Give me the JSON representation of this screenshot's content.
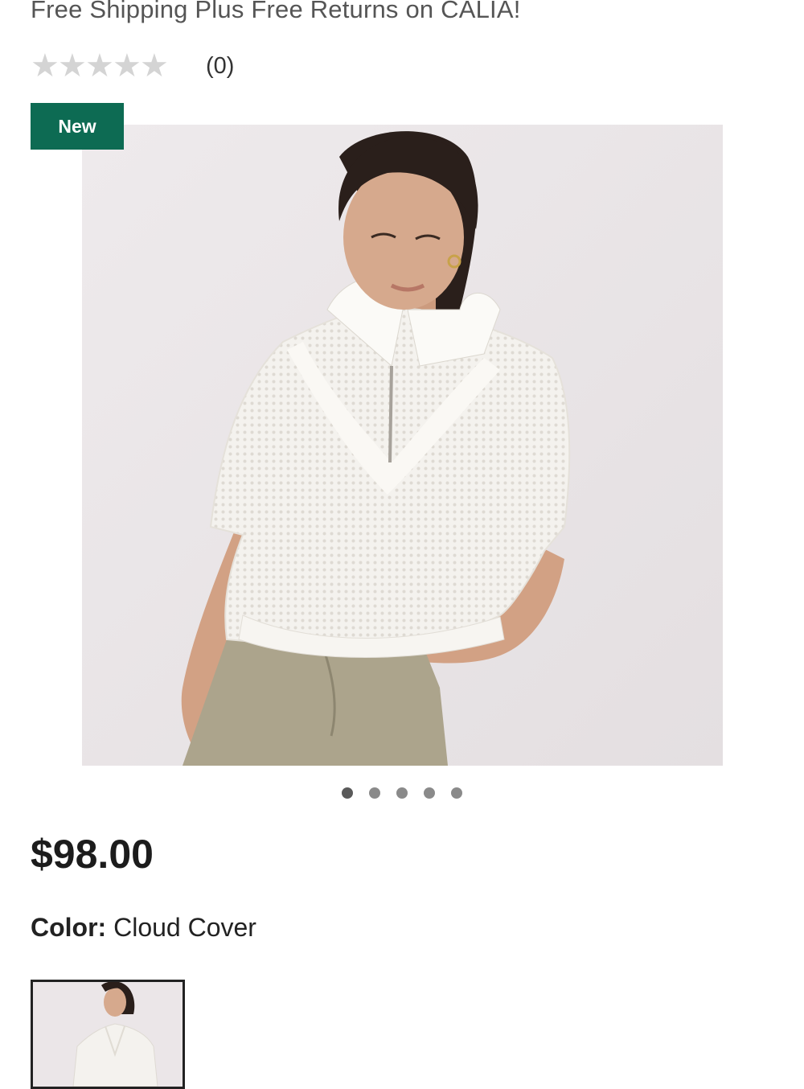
{
  "promo": {
    "text": "Free Shipping Plus Free Returns on CALIA!"
  },
  "rating": {
    "stars_filled": 0,
    "stars_total": 5,
    "count_text": "(0)",
    "star_color": "#d4d4d4"
  },
  "badge": {
    "label": "New",
    "color": "#0d6b53"
  },
  "gallery": {
    "slides_total": 5,
    "active_index": 0
  },
  "price": {
    "text": "$98.00"
  },
  "color": {
    "label": "Color:",
    "value": "Cloud Cover"
  },
  "swatches": [
    {
      "name": "Cloud Cover",
      "selected": true
    }
  ]
}
